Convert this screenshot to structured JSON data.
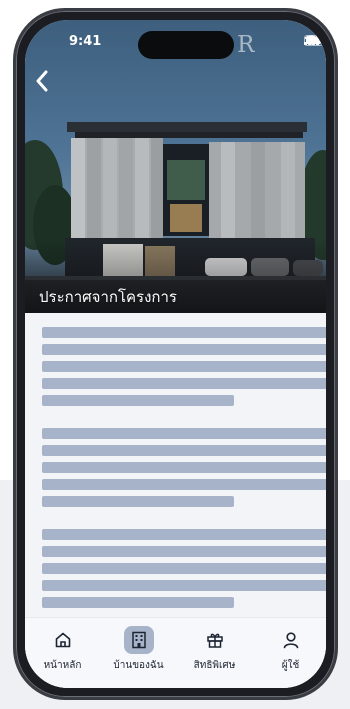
{
  "status_bar": {
    "time": "9:41"
  },
  "brand": {
    "watermark": "ARBOR"
  },
  "header": {
    "title": "ประกาศจากโครงการ"
  },
  "tab_bar": {
    "items": [
      {
        "label": "หน้าหลัก",
        "icon": "home-icon",
        "active": false
      },
      {
        "label": "บ้านของฉัน",
        "icon": "building-icon",
        "active": true
      },
      {
        "label": "สิทธิพิเศษ",
        "icon": "gift-icon",
        "active": false
      },
      {
        "label": "ผู้ใช้",
        "icon": "user-icon",
        "active": false
      }
    ]
  },
  "colors": {
    "placeholder": "#a7b3c9",
    "active_tab": "#a7b3c9",
    "screen_bg": "#f3f4f8",
    "text": "#1d2433"
  }
}
